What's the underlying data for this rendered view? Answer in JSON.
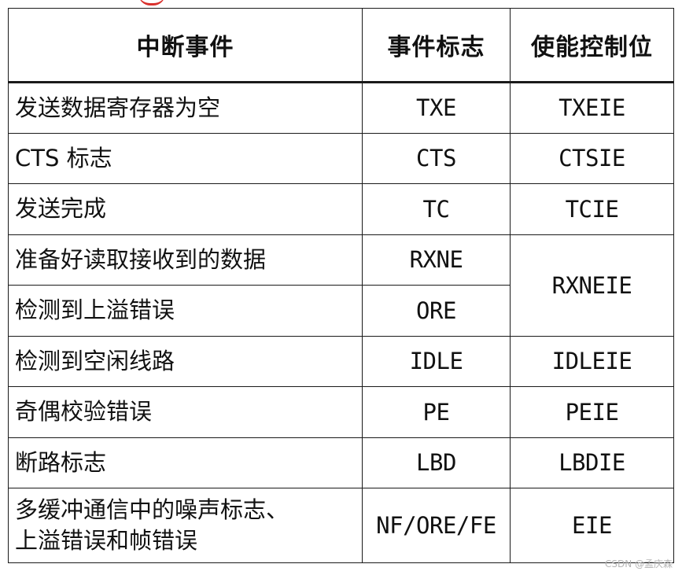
{
  "table": {
    "headers": {
      "event": "中断事件",
      "flag": "事件标志",
      "enable": "使能控制位"
    },
    "rows": [
      {
        "event": "发送数据寄存器为空",
        "flag": "TXE",
        "enable": "TXEIE"
      },
      {
        "event": "CTS 标志",
        "flag": "CTS",
        "enable": "CTSIE"
      },
      {
        "event": "发送完成",
        "flag": "TC",
        "enable": "TCIE"
      },
      {
        "event": "准备好读取接收到的数据",
        "flag": "RXNE",
        "enable": "RXNEIE"
      },
      {
        "event": "检测到上溢错误",
        "flag": "ORE"
      },
      {
        "event": "检测到空闲线路",
        "flag": "IDLE",
        "enable": "IDLEIE"
      },
      {
        "event": "奇偶校验错误",
        "flag": "PE",
        "enable": "PEIE"
      },
      {
        "event": "断路标志",
        "flag": "LBD",
        "enable": "LBDIE"
      },
      {
        "event": "多缓冲通信中的噪声标志、上溢错误和帧错误",
        "event_line1": "多缓冲通信中的噪声标志、",
        "event_line2": "上溢错误和帧错误",
        "flag": "NF/ORE/FE",
        "enable": "EIE"
      }
    ]
  },
  "watermark": "CSDN @孟庆森"
}
